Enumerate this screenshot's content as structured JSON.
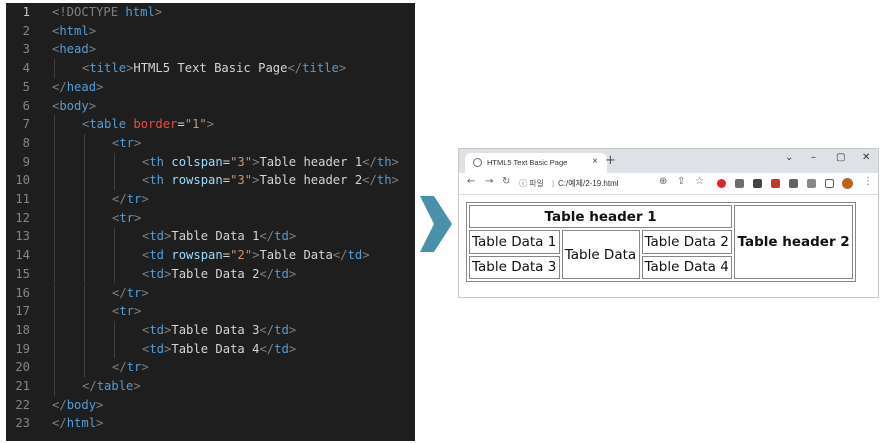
{
  "editor": {
    "lines": [
      {
        "n": "1",
        "indent": 0,
        "parts": [
          [
            "br",
            "<"
          ],
          [
            "doc",
            "!DOCTYPE "
          ],
          [
            "tag",
            "html"
          ],
          [
            "br",
            ">"
          ]
        ]
      },
      {
        "n": "2",
        "indent": 0,
        "parts": [
          [
            "br",
            "<"
          ],
          [
            "tag",
            "html"
          ],
          [
            "br",
            ">"
          ]
        ]
      },
      {
        "n": "3",
        "indent": 0,
        "parts": [
          [
            "br",
            "<"
          ],
          [
            "tag",
            "head"
          ],
          [
            "br",
            ">"
          ]
        ]
      },
      {
        "n": "4",
        "indent": 1,
        "parts": [
          [
            "br",
            "<"
          ],
          [
            "tag",
            "title"
          ],
          [
            "br",
            ">"
          ],
          [
            "txt",
            "HTML5 Text Basic Page"
          ],
          [
            "br",
            "</"
          ],
          [
            "tag",
            "title"
          ],
          [
            "br",
            ">"
          ]
        ]
      },
      {
        "n": "5",
        "indent": 0,
        "parts": [
          [
            "br",
            "</"
          ],
          [
            "tag",
            "head"
          ],
          [
            "br",
            ">"
          ]
        ]
      },
      {
        "n": "6",
        "indent": 0,
        "parts": [
          [
            "br",
            "<"
          ],
          [
            "tag",
            "body"
          ],
          [
            "br",
            ">"
          ]
        ]
      },
      {
        "n": "7",
        "indent": 1,
        "parts": [
          [
            "br",
            "<"
          ],
          [
            "tag",
            "table "
          ],
          [
            "attrred",
            "border"
          ],
          [
            "txt",
            "="
          ],
          [
            "str",
            "\"1\""
          ],
          [
            "br",
            ">"
          ]
        ]
      },
      {
        "n": "8",
        "indent": 2,
        "parts": [
          [
            "br",
            "<"
          ],
          [
            "tag",
            "tr"
          ],
          [
            "br",
            ">"
          ]
        ]
      },
      {
        "n": "9",
        "indent": 3,
        "parts": [
          [
            "br",
            "<"
          ],
          [
            "tag",
            "th "
          ],
          [
            "attr",
            "colspan"
          ],
          [
            "txt",
            "="
          ],
          [
            "str",
            "\"3\""
          ],
          [
            "br",
            ">"
          ],
          [
            "txt",
            "Table header 1"
          ],
          [
            "br",
            "</"
          ],
          [
            "tag",
            "th"
          ],
          [
            "br",
            ">"
          ]
        ]
      },
      {
        "n": "10",
        "indent": 3,
        "parts": [
          [
            "br",
            "<"
          ],
          [
            "tag",
            "th "
          ],
          [
            "attr",
            "rowspan"
          ],
          [
            "txt",
            "="
          ],
          [
            "str",
            "\"3\""
          ],
          [
            "br",
            ">"
          ],
          [
            "txt",
            "Table header 2"
          ],
          [
            "br",
            "</"
          ],
          [
            "tag",
            "th"
          ],
          [
            "br",
            ">"
          ]
        ]
      },
      {
        "n": "11",
        "indent": 2,
        "parts": [
          [
            "br",
            "</"
          ],
          [
            "tag",
            "tr"
          ],
          [
            "br",
            ">"
          ]
        ]
      },
      {
        "n": "12",
        "indent": 2,
        "parts": [
          [
            "br",
            "<"
          ],
          [
            "tag",
            "tr"
          ],
          [
            "br",
            ">"
          ]
        ]
      },
      {
        "n": "13",
        "indent": 3,
        "parts": [
          [
            "br",
            "<"
          ],
          [
            "tag",
            "td"
          ],
          [
            "br",
            ">"
          ],
          [
            "txt",
            "Table Data 1"
          ],
          [
            "br",
            "</"
          ],
          [
            "tag",
            "td"
          ],
          [
            "br",
            ">"
          ]
        ]
      },
      {
        "n": "14",
        "indent": 3,
        "parts": [
          [
            "br",
            "<"
          ],
          [
            "tag",
            "td "
          ],
          [
            "attr",
            "rowspan"
          ],
          [
            "txt",
            "="
          ],
          [
            "str",
            "\"2\""
          ],
          [
            "br",
            ">"
          ],
          [
            "txt",
            "Table Data"
          ],
          [
            "br",
            "</"
          ],
          [
            "tag",
            "td"
          ],
          [
            "br",
            ">"
          ]
        ]
      },
      {
        "n": "15",
        "indent": 3,
        "parts": [
          [
            "br",
            "<"
          ],
          [
            "tag",
            "td"
          ],
          [
            "br",
            ">"
          ],
          [
            "txt",
            "Table Data 2"
          ],
          [
            "br",
            "</"
          ],
          [
            "tag",
            "td"
          ],
          [
            "br",
            ">"
          ]
        ]
      },
      {
        "n": "16",
        "indent": 2,
        "parts": [
          [
            "br",
            "</"
          ],
          [
            "tag",
            "tr"
          ],
          [
            "br",
            ">"
          ]
        ]
      },
      {
        "n": "17",
        "indent": 2,
        "parts": [
          [
            "br",
            "<"
          ],
          [
            "tag",
            "tr"
          ],
          [
            "br",
            ">"
          ]
        ]
      },
      {
        "n": "18",
        "indent": 3,
        "parts": [
          [
            "br",
            "<"
          ],
          [
            "tag",
            "td"
          ],
          [
            "br",
            ">"
          ],
          [
            "txt",
            "Table Data 3"
          ],
          [
            "br",
            "</"
          ],
          [
            "tag",
            "td"
          ],
          [
            "br",
            ">"
          ]
        ]
      },
      {
        "n": "19",
        "indent": 3,
        "parts": [
          [
            "br",
            "<"
          ],
          [
            "tag",
            "td"
          ],
          [
            "br",
            ">"
          ],
          [
            "txt",
            "Table Data 4"
          ],
          [
            "br",
            "</"
          ],
          [
            "tag",
            "td"
          ],
          [
            "br",
            ">"
          ]
        ]
      },
      {
        "n": "20",
        "indent": 2,
        "parts": [
          [
            "br",
            "</"
          ],
          [
            "tag",
            "tr"
          ],
          [
            "br",
            ">"
          ]
        ]
      },
      {
        "n": "21",
        "indent": 1,
        "parts": [
          [
            "br",
            "</"
          ],
          [
            "tag",
            "table"
          ],
          [
            "br",
            ">"
          ]
        ]
      },
      {
        "n": "22",
        "indent": 0,
        "parts": [
          [
            "br",
            "</"
          ],
          [
            "tag",
            "body"
          ],
          [
            "br",
            ">"
          ]
        ]
      },
      {
        "n": "23",
        "indent": 0,
        "parts": [
          [
            "br",
            "</"
          ],
          [
            "tag",
            "html"
          ],
          [
            "br",
            ">"
          ]
        ]
      }
    ]
  },
  "browser": {
    "tab_title": "HTML5 Text Basic Page",
    "tab_close": "×",
    "new_tab": "+",
    "window_controls": [
      "⌄",
      "–",
      "▢",
      "✕"
    ],
    "nav": {
      "back": "←",
      "forward": "→",
      "reload": "↻"
    },
    "url_info": "ⓘ 파일",
    "url_path": "C:/예제/2-19.html",
    "toolbar_icons": [
      "⊕",
      "⇪",
      "☆",
      "⋮"
    ],
    "table": {
      "header1": "Table header 1",
      "header2": "Table header 2",
      "data1": "Table Data 1",
      "data_span": "Table Data",
      "data2": "Table Data 2",
      "data3": "Table Data 3",
      "data4": "Table Data 4"
    }
  },
  "colors": {
    "editor_bg": "#1e1e1e",
    "arrow": "#4a90a8",
    "tag": "#569cd6",
    "attr": "#9cdcfe",
    "string": "#ce9178"
  }
}
